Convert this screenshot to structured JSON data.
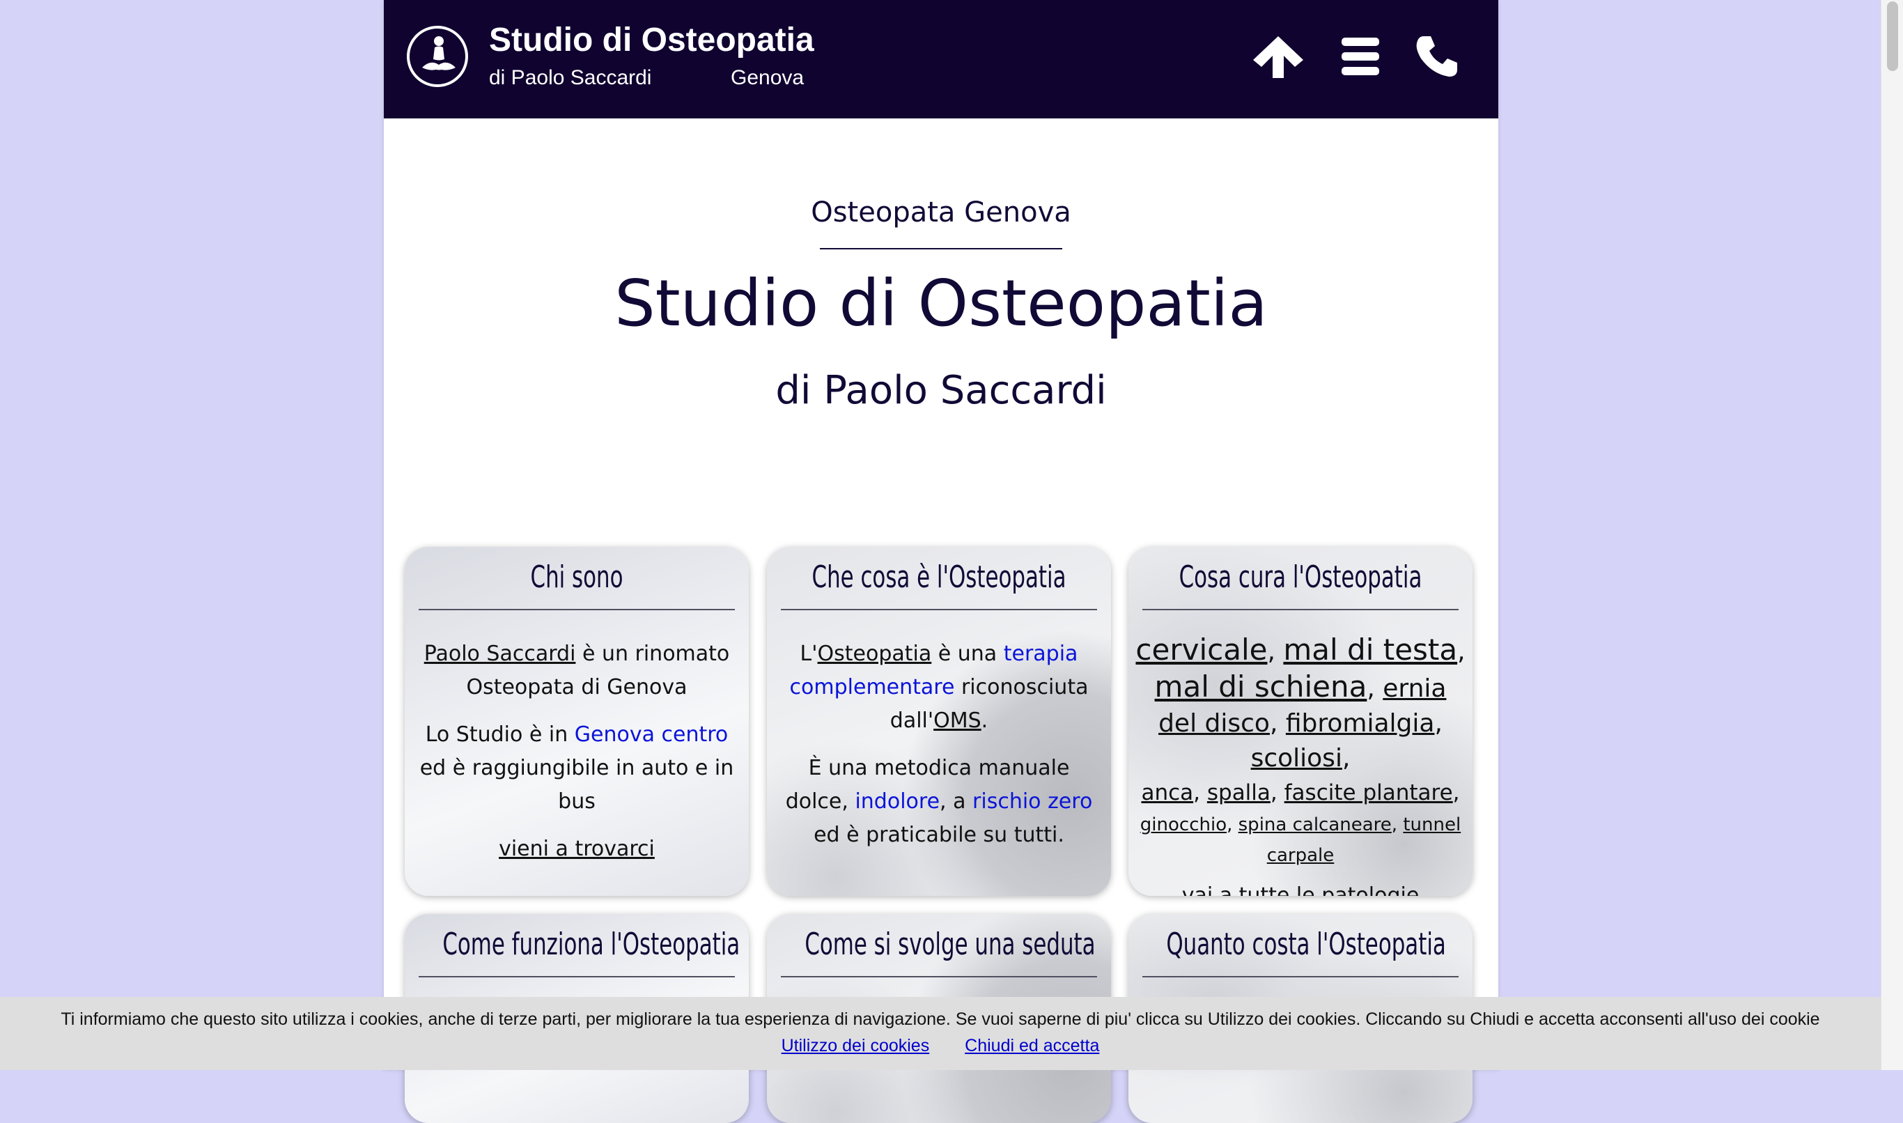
{
  "header": {
    "brand_title": "Studio di Osteopatia",
    "brand_sub": "di Paolo Saccardi",
    "brand_city": "Genova",
    "colors": {
      "background": "#100330",
      "text": "#ffffff"
    },
    "icons": [
      "logo-meditation-icon",
      "arrow-up-icon",
      "hamburger-menu-icon",
      "phone-icon"
    ]
  },
  "hero": {
    "kicker": "Osteopata Genova",
    "title": "Studio di Osteopatia",
    "subtitle": "di Paolo Saccardi"
  },
  "cards": [
    {
      "title": "Chi sono",
      "p1_link": "Paolo Saccardi",
      "p1_text": " è un rinomato Osteopata di Genova",
      "p2_a": "Lo Studio è in ",
      "p2_blue": "Genova centro",
      "p2_b": " ed è raggiungibile in auto e in bus",
      "link": "vieni a trovarci"
    },
    {
      "title": "Che cosa è l'Osteopatia",
      "p1_a": "L'",
      "p1_link": "Osteopatia",
      "p1_b": " è una ",
      "p1_blue": "terapia complementare",
      "p1_c": " riconosciuta dall'",
      "p1_link2": "OMS",
      "p1_d": ".",
      "p2_a": "È una metodica manuale dolce, ",
      "p2_blue1": "indolore",
      "p2_b": ", a ",
      "p2_blue2": "rischio zero",
      "p2_c": " ed è praticabile su tutti."
    },
    {
      "title": "Cosa cura l'Osteopatia",
      "pathologies": {
        "cervicale": "cervicale",
        "mal_di_testa": "mal di testa",
        "mal_di_schiena": "mal di schiena",
        "ernia_del_disco": "ernia del disco",
        "fibromialgia": "fibromialgia",
        "scoliosi": "scoliosi",
        "anca": "anca",
        "spalla": "spalla",
        "fascite_plantare": "fascite plantare",
        "ginocchio": "ginocchio",
        "spina_calcaneare": "spina calcaneare",
        "tunnel_carpale": "tunnel carpale"
      },
      "link": "vai a tutte le patologie"
    },
    {
      "title": "Come funziona l'Osteopatia"
    },
    {
      "title": "Come si svolge una seduta"
    },
    {
      "title": "Quanto costa l'Osteopatia"
    }
  ],
  "cookie_banner": {
    "text": "Ti informiamo che questo sito utilizza i cookies, anche di terze parti, per migliorare la tua esperienza di navigazione. Se vuoi saperne di piu' clicca su Utilizzo dei cookies. Cliccando su Chiudi e accetta acconsenti all'uso dei cookie",
    "link_info": "Utilizzo dei cookies",
    "link_accept": "Chiudi ed accetta"
  },
  "colors": {
    "page_bg": "#d5d3f7",
    "link_blue": "#0b14d8",
    "text_dark": "#110a36"
  }
}
